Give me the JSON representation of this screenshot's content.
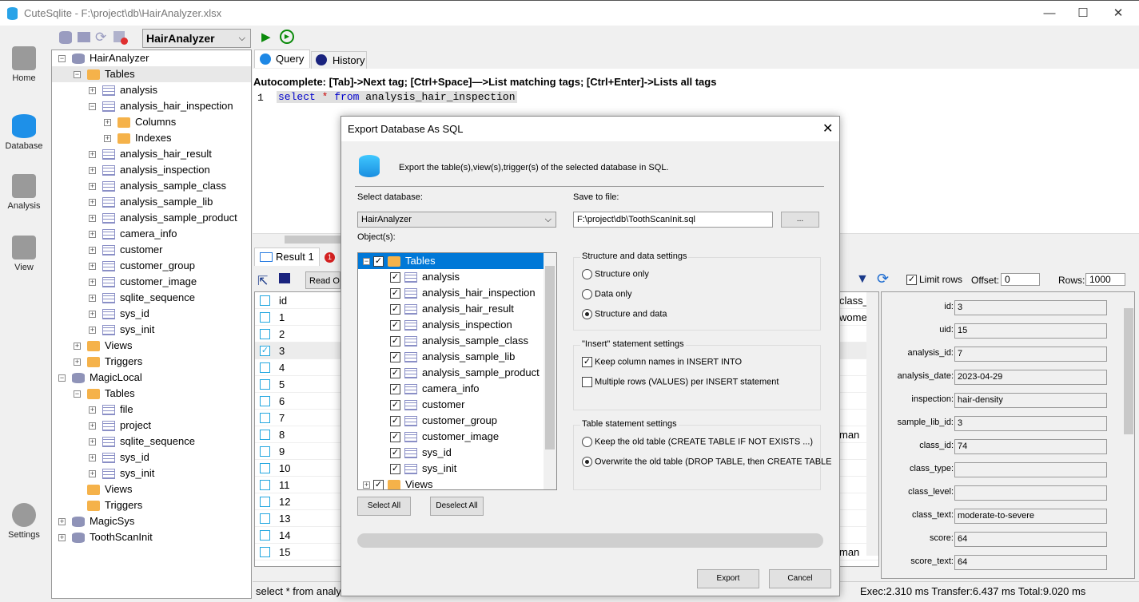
{
  "window": {
    "title": "CuteSqlite - F:\\project\\db\\HairAnalyzer.xlsx",
    "minimize": "—",
    "maximize": "☐",
    "close": "✕"
  },
  "nav": [
    {
      "label": "Home",
      "icon": "home-icon"
    },
    {
      "label": "Database",
      "icon": "database-icon"
    },
    {
      "label": "Analysis",
      "icon": "analysis-icon"
    },
    {
      "label": "View",
      "icon": "view-icon"
    },
    {
      "label": "Settings",
      "icon": "gear-icon"
    }
  ],
  "db_selector": {
    "value": "HairAnalyzer"
  },
  "tree": [
    {
      "label": "HairAnalyzer",
      "level": 0,
      "type": "db",
      "exp": "−"
    },
    {
      "label": "Tables",
      "level": 1,
      "type": "folder",
      "exp": "−",
      "selected": true
    },
    {
      "label": "analysis",
      "level": 2,
      "type": "table",
      "exp": "+"
    },
    {
      "label": "analysis_hair_inspection",
      "level": 2,
      "type": "table",
      "exp": "−"
    },
    {
      "label": "Columns",
      "level": 3,
      "type": "folder",
      "exp": "+"
    },
    {
      "label": "Indexes",
      "level": 3,
      "type": "folder",
      "exp": "+"
    },
    {
      "label": "analysis_hair_result",
      "level": 2,
      "type": "table",
      "exp": "+"
    },
    {
      "label": "analysis_inspection",
      "level": 2,
      "type": "table",
      "exp": "+"
    },
    {
      "label": "analysis_sample_class",
      "level": 2,
      "type": "table",
      "exp": "+"
    },
    {
      "label": "analysis_sample_lib",
      "level": 2,
      "type": "table",
      "exp": "+"
    },
    {
      "label": "analysis_sample_product",
      "level": 2,
      "type": "table",
      "exp": "+"
    },
    {
      "label": "camera_info",
      "level": 2,
      "type": "table",
      "exp": "+"
    },
    {
      "label": "customer",
      "level": 2,
      "type": "table",
      "exp": "+"
    },
    {
      "label": "customer_group",
      "level": 2,
      "type": "table",
      "exp": "+"
    },
    {
      "label": "customer_image",
      "level": 2,
      "type": "table",
      "exp": "+"
    },
    {
      "label": "sqlite_sequence",
      "level": 2,
      "type": "table",
      "exp": "+"
    },
    {
      "label": "sys_id",
      "level": 2,
      "type": "table",
      "exp": "+"
    },
    {
      "label": "sys_init",
      "level": 2,
      "type": "table",
      "exp": "+"
    },
    {
      "label": "Views",
      "level": 1,
      "type": "folder",
      "exp": "+"
    },
    {
      "label": "Triggers",
      "level": 1,
      "type": "folder",
      "exp": "+"
    },
    {
      "label": "MagicLocal",
      "level": 0,
      "type": "db",
      "exp": "−"
    },
    {
      "label": "Tables",
      "level": 1,
      "type": "folder",
      "exp": "−"
    },
    {
      "label": "file",
      "level": 2,
      "type": "table",
      "exp": "+"
    },
    {
      "label": "project",
      "level": 2,
      "type": "table",
      "exp": "+"
    },
    {
      "label": "sqlite_sequence",
      "level": 2,
      "type": "table",
      "exp": "+"
    },
    {
      "label": "sys_id",
      "level": 2,
      "type": "table",
      "exp": "+"
    },
    {
      "label": "sys_init",
      "level": 2,
      "type": "table",
      "exp": "+"
    },
    {
      "label": "Views",
      "level": 1,
      "type": "folder",
      "exp": ""
    },
    {
      "label": "Triggers",
      "level": 1,
      "type": "folder",
      "exp": ""
    },
    {
      "label": "MagicSys",
      "level": 0,
      "type": "db",
      "exp": "+"
    },
    {
      "label": "ToothScanInit",
      "level": 0,
      "type": "db",
      "exp": "+"
    }
  ],
  "tabs": {
    "query": "Query",
    "history": "History"
  },
  "editor": {
    "hint": "Autocomplete: [Tab]->Next tag; [Ctrl+Space]—>List matching tags; [Ctrl+Enter]->Lists all tags",
    "line_no": "1",
    "kw1": "select",
    "star": "*",
    "kw2": "from",
    "table": "analysis_hair_inspection"
  },
  "result": {
    "tab": "Result 1",
    "badge": "1",
    "readonly": "Read Only",
    "limit_rows": "Limit rows",
    "offset_label": "Offset:",
    "offset": "0",
    "rows_label": "Rows:",
    "rows": "1000",
    "header": "id",
    "ids": [
      "1",
      "2",
      "3",
      "4",
      "5",
      "6",
      "7",
      "8",
      "9",
      "10",
      "11",
      "12",
      "13",
      "14",
      "15"
    ],
    "selected_id": "3",
    "right_col_header": "class_",
    "right_col": {
      "1": "wome",
      "8": "man",
      "15": "man"
    }
  },
  "detail": [
    {
      "k": "id:",
      "v": "3"
    },
    {
      "k": "uid:",
      "v": "15"
    },
    {
      "k": "analysis_id:",
      "v": "7"
    },
    {
      "k": "analysis_date:",
      "v": "2023-04-29"
    },
    {
      "k": "inspection:",
      "v": "hair-density"
    },
    {
      "k": "sample_lib_id:",
      "v": "3"
    },
    {
      "k": "class_id:",
      "v": "74"
    },
    {
      "k": "class_type:",
      "v": ""
    },
    {
      "k": "class_level:",
      "v": ""
    },
    {
      "k": "class_text:",
      "v": "moderate-to-severe"
    },
    {
      "k": "score:",
      "v": "64"
    },
    {
      "k": "score_text:",
      "v": "64"
    }
  ],
  "status": {
    "left": "select * from analy",
    "right": "Exec:2.310 ms Transfer:6.437 ms Total:9.020 ms"
  },
  "dialog": {
    "title": "Export Database As SQL",
    "desc": "Export the table(s),view(s),trigger(s) of the selected database in SQL.",
    "select_db_label": "Select database:",
    "select_db": "HairAnalyzer",
    "save_label": "Save to file:",
    "save_path": "F:\\project\\db\\ToothScanInit.sql",
    "browse": "...",
    "objects_label": "Object(s):",
    "objects": [
      "Tables",
      "analysis",
      "analysis_hair_inspection",
      "analysis_hair_result",
      "analysis_inspection",
      "analysis_sample_class",
      "analysis_sample_lib",
      "analysis_sample_product",
      "camera_info",
      "customer",
      "customer_group",
      "customer_image",
      "sys_id",
      "sys_init",
      "Views"
    ],
    "select_all": "Select All",
    "deselect_all": "Deselect All",
    "g1": {
      "title": "Structure and data settings",
      "opts": [
        "Structure only",
        "Data only",
        "Structure and data"
      ],
      "selected": 2
    },
    "g2": {
      "title": "\"Insert\" statement settings",
      "opts": [
        "Keep column names in INSERT INTO",
        "Multiple rows (VALUES) per INSERT statement"
      ],
      "checked": [
        true,
        false
      ]
    },
    "g3": {
      "title": "Table statement settings",
      "opts": [
        "Keep the old table (CREATE TABLE IF NOT EXISTS ...)",
        "Overwrite the old table (DROP TABLE, then CREATE TABLE"
      ],
      "selected": 1
    },
    "export": "Export",
    "cancel": "Cancel",
    "progress": 0
  },
  "colors": {
    "accent": "#0078d7",
    "run": "#0a8a0a",
    "checkbox": "#23a7e0"
  }
}
